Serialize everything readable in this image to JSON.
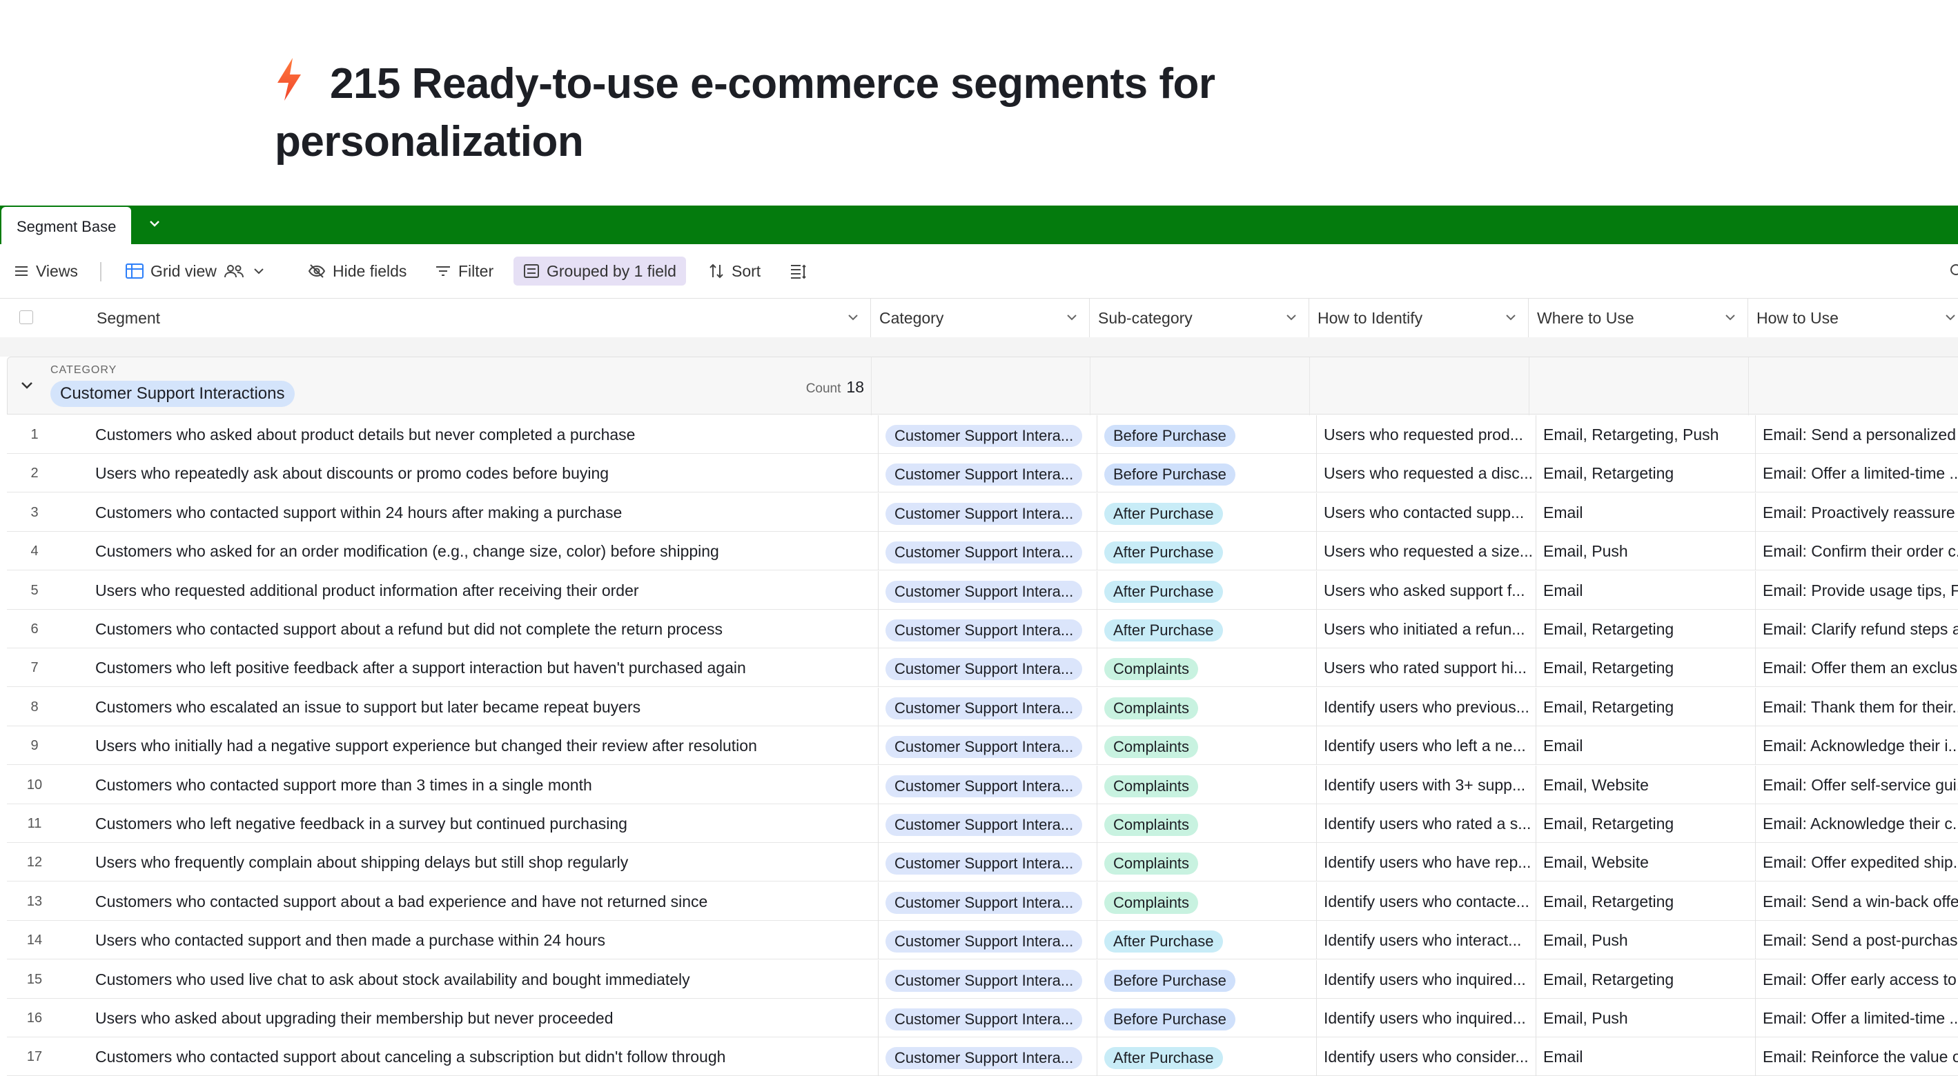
{
  "page": {
    "title": "215 Ready-to-use e-commerce segments for personalization",
    "title_icon": "lightning-bolt-icon"
  },
  "tabs": {
    "active": "Segment Base",
    "bar_color": "#047b0d"
  },
  "toolbar": {
    "views": "Views",
    "grid_view": "Grid view",
    "hide_fields": "Hide fields",
    "filter": "Filter",
    "grouped": "Grouped by 1 field",
    "sort": "Sort"
  },
  "columns": [
    "Segment",
    "Category",
    "Sub-category",
    "How to Identify",
    "Where to Use",
    "How to Use"
  ],
  "group": {
    "label": "CATEGORY",
    "name": "Customer Support Interactions",
    "count_label": "Count",
    "count": "18"
  },
  "rows": [
    {
      "n": "1",
      "segment": "Customers who asked about product details but never completed a purchase",
      "category": "Customer Support Intera...",
      "sub": "Before Purchase",
      "ident": "Users who requested prod...",
      "where": "Email, Retargeting, Push",
      "how": "Email: Send a personalized ..."
    },
    {
      "n": "2",
      "segment": "Users who repeatedly ask about discounts or promo codes before buying",
      "category": "Customer Support Intera...",
      "sub": "Before Purchase",
      "ident": "Users who requested a disc...",
      "where": "Email, Retargeting",
      "how": "Email: Offer a limited-time ..."
    },
    {
      "n": "3",
      "segment": "Customers who contacted support within 24 hours after making a purchase",
      "category": "Customer Support Intera...",
      "sub": "After Purchase",
      "ident": "Users who contacted supp...",
      "where": "Email",
      "how": "Email: Proactively reassure ..."
    },
    {
      "n": "4",
      "segment": "Customers who asked for an order modification (e.g., change size, color) before shipping",
      "category": "Customer Support Intera...",
      "sub": "After Purchase",
      "ident": "Users who requested a size...",
      "where": "Email, Push",
      "how": "Email: Confirm their order c..."
    },
    {
      "n": "5",
      "segment": "Users who requested additional product information after receiving their order",
      "category": "Customer Support Intera...",
      "sub": "After Purchase",
      "ident": "Users who asked support f...",
      "where": "Email",
      "how": "Email: Provide usage tips, F..."
    },
    {
      "n": "6",
      "segment": "Customers who contacted support about a refund but did not complete the return process",
      "category": "Customer Support Intera...",
      "sub": "After Purchase",
      "ident": "Users who initiated a refun...",
      "where": "Email, Retargeting",
      "how": "Email: Clarify refund steps a..."
    },
    {
      "n": "7",
      "segment": "Customers who left positive feedback after a support interaction but haven't purchased again",
      "category": "Customer Support Intera...",
      "sub": "Complaints",
      "ident": "Users who rated support hi...",
      "where": "Email, Retargeting",
      "how": "Email: Offer them an exclus..."
    },
    {
      "n": "8",
      "segment": "Customers who escalated an issue to support but later became repeat buyers",
      "category": "Customer Support Intera...",
      "sub": "Complaints",
      "ident": "Identify users who previous...",
      "where": "Email, Retargeting",
      "how": "Email: Thank them for their..."
    },
    {
      "n": "9",
      "segment": "Users who initially had a negative support experience but changed their review after resolution",
      "category": "Customer Support Intera...",
      "sub": "Complaints",
      "ident": "Identify users who left a ne...",
      "where": "Email",
      "how": "Email: Acknowledge their i..."
    },
    {
      "n": "10",
      "segment": "Customers who contacted support more than 3 times in a single month",
      "category": "Customer Support Intera...",
      "sub": "Complaints",
      "ident": "Identify users with 3+ supp...",
      "where": "Email, Website",
      "how": "Email: Offer self-service gui..."
    },
    {
      "n": "11",
      "segment": "Customers who left negative feedback in a survey but continued purchasing",
      "category": "Customer Support Intera...",
      "sub": "Complaints",
      "ident": "Identify users who rated a s...",
      "where": "Email, Retargeting",
      "how": "Email: Acknowledge their c..."
    },
    {
      "n": "12",
      "segment": "Users who frequently complain about shipping delays but still shop regularly",
      "category": "Customer Support Intera...",
      "sub": "Complaints",
      "ident": "Identify users who have rep...",
      "where": "Email, Website",
      "how": "Email: Offer expedited ship..."
    },
    {
      "n": "13",
      "segment": "Customers who contacted support about a bad experience and have not returned since",
      "category": "Customer Support Intera...",
      "sub": "Complaints",
      "ident": "Identify users who contacte...",
      "where": "Email, Retargeting",
      "how": "Email: Send a win-back offe..."
    },
    {
      "n": "14",
      "segment": "Users who contacted support and then made a purchase within 24 hours",
      "category": "Customer Support Intera...",
      "sub": "After Purchase",
      "ident": "Identify users who interact...",
      "where": "Email, Push",
      "how": "Email: Send a post-purchas..."
    },
    {
      "n": "15",
      "segment": "Customers who used live chat to ask about stock availability and bought immediately",
      "category": "Customer Support Intera...",
      "sub": "Before Purchase",
      "ident": "Identify users who inquired...",
      "where": "Email, Retargeting",
      "how": "Email: Offer early access to ..."
    },
    {
      "n": "16",
      "segment": "Users who asked about upgrading their membership but never proceeded",
      "category": "Customer Support Intera...",
      "sub": "Before Purchase",
      "ident": "Identify users who inquired...",
      "where": "Email, Push",
      "how": "Email: Offer a limited-time ..."
    },
    {
      "n": "17",
      "segment": "Customers who contacted support about canceling a subscription but didn't follow through",
      "category": "Customer Support Intera...",
      "sub": "After Purchase",
      "ident": "Identify users who consider...",
      "where": "Email",
      "how": "Email: Reinforce the value o..."
    }
  ]
}
